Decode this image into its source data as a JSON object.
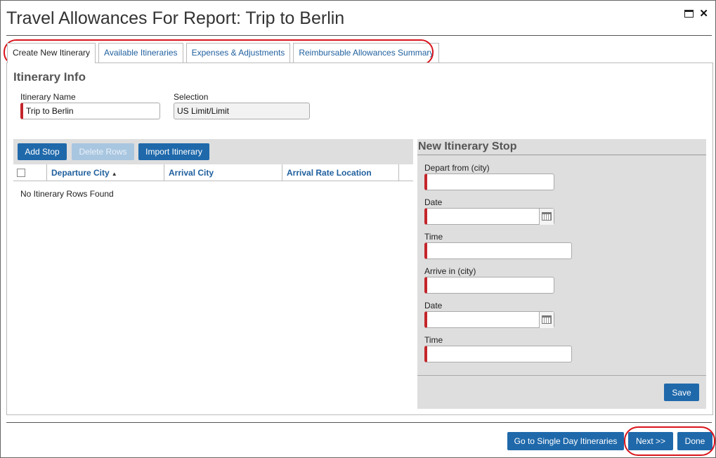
{
  "dialog": {
    "title": "Travel Allowances For Report: Trip to Berlin"
  },
  "tabs": [
    {
      "label": "Create New Itinerary"
    },
    {
      "label": "Available Itineraries"
    },
    {
      "label": "Expenses & Adjustments"
    },
    {
      "label": "Reimbursable Allowances Summary"
    }
  ],
  "itinerary_info": {
    "section_title": "Itinerary Info",
    "name_label": "Itinerary Name",
    "name_value": "Trip to Berlin",
    "selection_label": "Selection",
    "selection_value": "US Limit/Limit"
  },
  "toolbar": {
    "add_stop": "Add Stop",
    "delete_rows": "Delete Rows",
    "import_itinerary": "Import Itinerary"
  },
  "grid": {
    "columns": [
      "Departure City",
      "Arrival City",
      "Arrival Rate Location"
    ],
    "sort_indicator": "▲",
    "empty_message": "No Itinerary Rows Found"
  },
  "new_stop": {
    "title": "New Itinerary Stop",
    "depart_label": "Depart from (city)",
    "depart_date_label": "Date",
    "depart_time_label": "Time",
    "arrive_label": "Arrive in (city)",
    "arrive_date_label": "Date",
    "arrive_time_label": "Time",
    "save_label": "Save"
  },
  "footer": {
    "single_day": "Go to Single Day Itineraries",
    "next": "Next >>",
    "done": "Done"
  },
  "colors": {
    "primary": "#1f69ab",
    "required": "#c4252b",
    "highlight": "#d9141b"
  }
}
